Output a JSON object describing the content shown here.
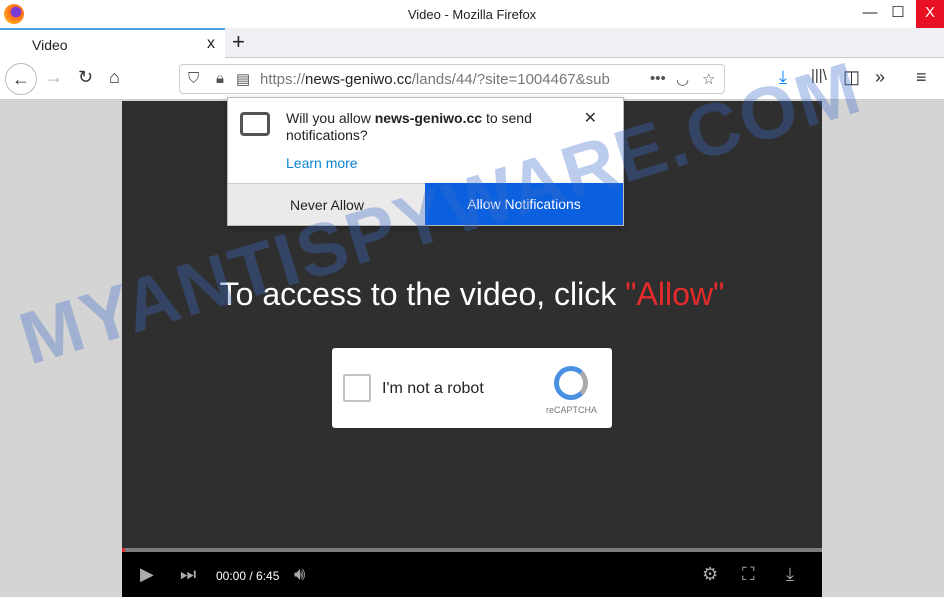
{
  "window": {
    "title": "Video - Mozilla Firefox",
    "minimize": "—",
    "maximize": "☐",
    "close": "X"
  },
  "tab": {
    "label": "Video",
    "close": "x",
    "new_tab": "+"
  },
  "nav": {
    "url_prefix": "https://",
    "url_domain": "news-geniwo.cc",
    "url_rest": "/lands/44/?site=1004467&sub",
    "more": "•••"
  },
  "popup": {
    "message_pre": "Will you allow ",
    "message_domain": "news-geniwo.cc",
    "message_post": " to send notifications?",
    "learn_more": "Learn more",
    "never": "Never Allow",
    "allow": "Allow Notifications",
    "close": "✕"
  },
  "video": {
    "headline": "To access to the video, click ",
    "headline_allow": "\"Allow\"",
    "time": "00:00 / 6:45",
    "progress": 0.004
  },
  "captcha": {
    "label": "I'm not a robot",
    "brand": "reCAPTCHA"
  },
  "watermark": "MYANTISPYWARE.COM",
  "colors": {
    "accent": "#0a60df",
    "allow_red": "#e52b2b",
    "close_red": "#e81123"
  }
}
